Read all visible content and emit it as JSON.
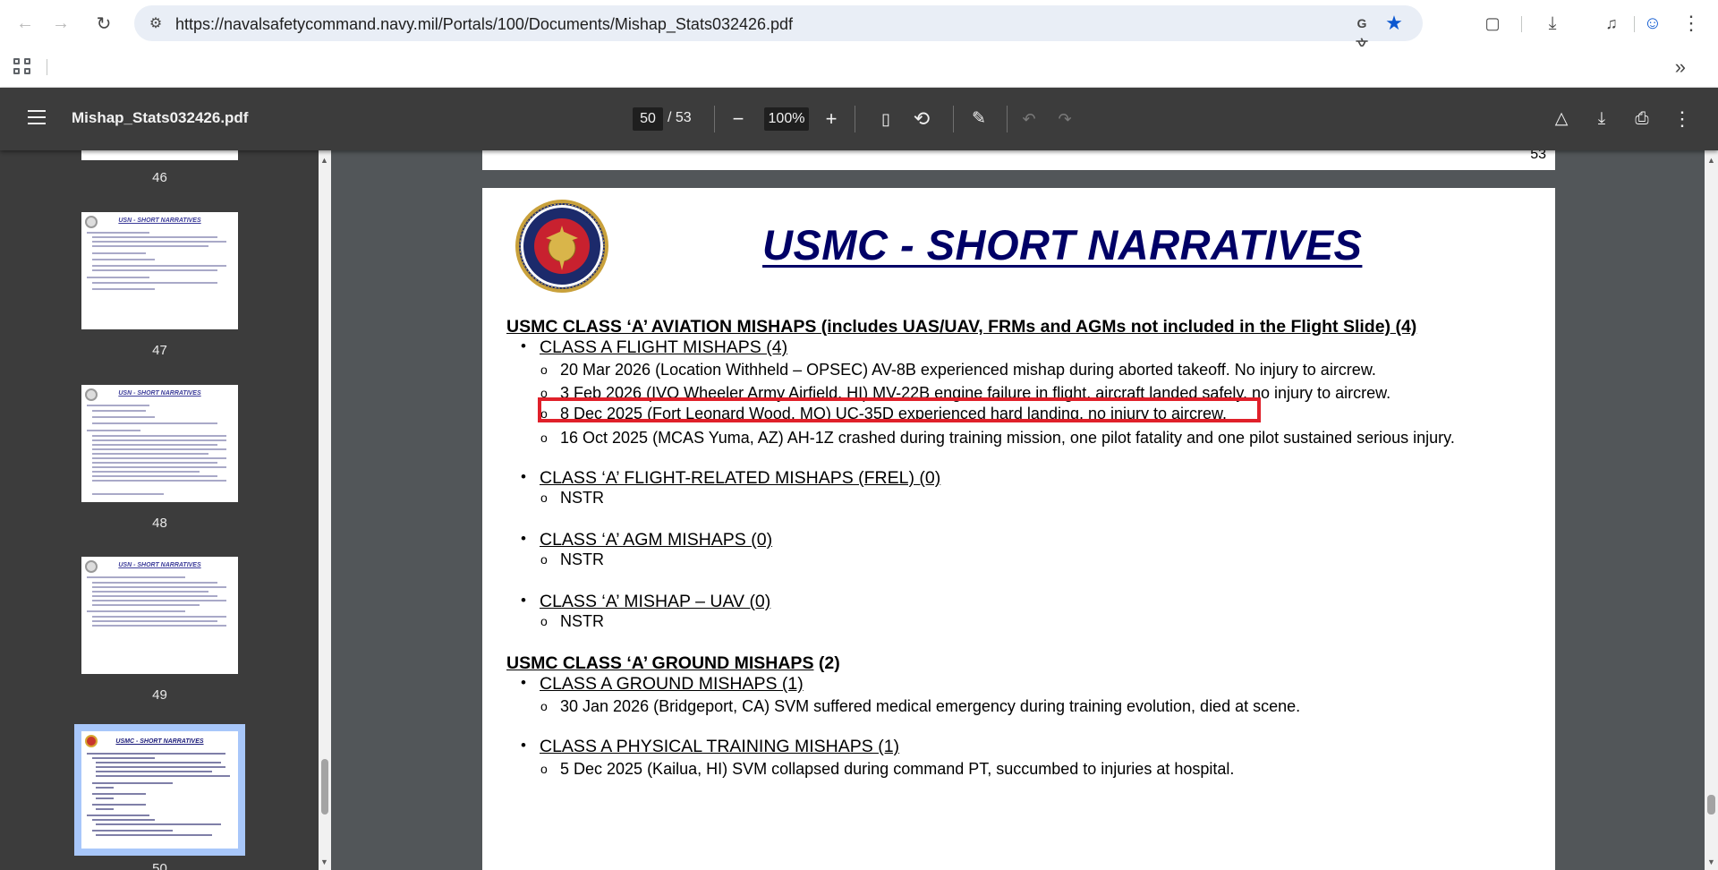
{
  "browser": {
    "url": "https://navalsafetycommand.navy.mil/Portals/100/Documents/Mishap_Stats032426.pdf"
  },
  "pdf_toolbar": {
    "title": "Mishap_Stats032426.pdf",
    "current_page": "50",
    "total_pages": "/ 53",
    "zoom": "100%"
  },
  "sidebar": {
    "thumbnails": [
      {
        "label": "46"
      },
      {
        "label": "47",
        "title": "USN - SHORT NARRATIVES"
      },
      {
        "label": "48",
        "title": "USN - SHORT NARRATIVES"
      },
      {
        "label": "49",
        "title": "USN - SHORT NARRATIVES"
      },
      {
        "label": "50",
        "title": "USMC - SHORT NARRATIVES"
      }
    ]
  },
  "prev_page": {
    "page_number": "53"
  },
  "document": {
    "title": "USMC - SHORT NARRATIVES",
    "aviation_header": "USMC CLASS ‘A’ AVIATION MISHAPS (includes UAS/UAV, FRMs and AGMs not included in the Flight Slide)  (4)",
    "flight_cat": "CLASS A FLIGHT MISHAPS (4)",
    "flight_items": [
      "20 Mar 2026 (Location Withheld – OPSEC) AV-8B experienced mishap during aborted takeoff.  No injury to aircrew.",
      "3 Feb 2026 (IVO Wheeler Army Airfield, HI) MV-22B engine failure in flight, aircraft landed safely, no injury to aircrew.",
      "8 Dec 2025 (Fort Leonard Wood, MO) UC-35D experienced hard landing, no injury to aircrew.",
      "16 Oct 2025 (MCAS Yuma, AZ) AH-1Z crashed during training mission, one pilot fatality and one pilot sustained serious injury."
    ],
    "frel_cat": "CLASS ‘A’ FLIGHT-RELATED MISHAPS (FREL) (0)",
    "frel_item": "NSTR",
    "agm_cat": "CLASS ‘A’ AGM MISHAPS (0)",
    "agm_item": "NSTR",
    "uav_cat": "CLASS ‘A’ MISHAP – UAV (0)",
    "uav_item": "NSTR",
    "ground_header": "USMC CLASS ‘A’ GROUND MISHAPS",
    "ground_header_count": " (2)",
    "ground_cat": "CLASS A GROUND MISHAPS (1)",
    "ground_item": "30 Jan 2026 (Bridgeport, CA) SVM suffered medical emergency during training evolution, died at scene.",
    "pt_cat": "CLASS A PHYSICAL TRAINING MISHAPS (1)",
    "pt_item": "5 Dec 2025 (Kailua, HI) SVM collapsed during command PT, succumbed to injuries at hospital."
  },
  "colors": {
    "highlight": "#e0202a",
    "title_navy": "#000066",
    "toolbar_bg": "#3c3c3c",
    "viewer_bg": "#525659"
  }
}
